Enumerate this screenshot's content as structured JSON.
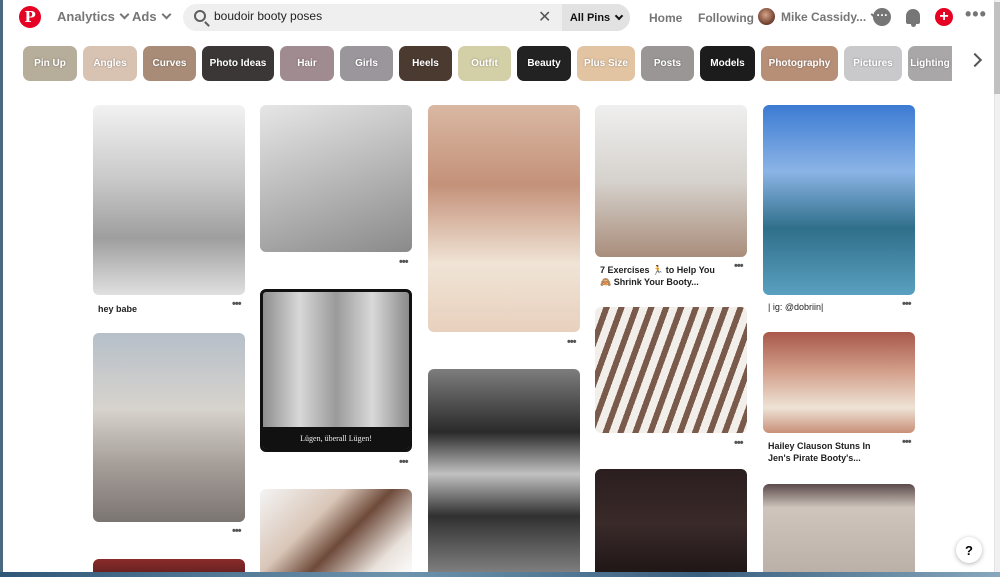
{
  "header": {
    "logo": "P",
    "analytics_label": "Analytics",
    "ads_label": "Ads",
    "search_value": "boudoir booty poses",
    "search_scope": "All Pins",
    "clear_label": "✕",
    "home_label": "Home",
    "following_label": "Following",
    "user_name": "Mike Cassidy..."
  },
  "chips": [
    {
      "label": "Pin Up",
      "color": "#b6ad9a"
    },
    {
      "label": "Angles",
      "color": "#d8c3b3"
    },
    {
      "label": "Curves",
      "color": "#a88c78"
    },
    {
      "label": "Photo Ideas",
      "color": "#3c3737"
    },
    {
      "label": "Hair",
      "color": "#a08b91"
    },
    {
      "label": "Girls",
      "color": "#9b969c"
    },
    {
      "label": "Heels",
      "color": "#4a3a30"
    },
    {
      "label": "Outfit",
      "color": "#d3cfa6"
    },
    {
      "label": "Beauty",
      "color": "#222222"
    },
    {
      "label": "Plus Size",
      "color": "#e2c4a2"
    },
    {
      "label": "Posts",
      "color": "#9a9696"
    },
    {
      "label": "Models",
      "color": "#1c1c1c"
    },
    {
      "label": "Photography",
      "color": "#b78f77"
    },
    {
      "label": "Pictures",
      "color": "#c9c9cb"
    },
    {
      "label": "Lighting",
      "color": "#a9a7a7"
    }
  ],
  "pins": [
    {
      "title": "hey babe",
      "bg": "linear-gradient(180deg,#f2f2f2 0%,#c8c8c8 40%,#9e9e9e 70%,#e0e0e0 100%)"
    },
    {
      "title": "",
      "bg": "linear-gradient(160deg,#e6e6e6 0%,#bdbdbd 45%,#8a8a8a 100%)"
    },
    {
      "title": "",
      "bg": "linear-gradient(180deg,#d9b8a3 0%,#c49179 35%,#f0e4d6 70%,#e8d0bd 100%)"
    },
    {
      "title": "7 Exercises 🏃 to Help You 🙈 Shrink Your Booty...",
      "bg": "linear-gradient(180deg,#efefef 0%,#d6d2cd 50%,#a98d7b 100%)"
    },
    {
      "title": "| ig: @dobriin|",
      "bg": "linear-gradient(180deg,#3c7bd3 0%,#8bb4e6 35%,#2f6f8a 65%,#5aa0c0 100%)"
    },
    {
      "title": "",
      "bg": "linear-gradient(180deg,#b6bfc9 0%,#d7d3cd 40%,#a59d98 70%,#7b7572 100%)"
    },
    {
      "title": "",
      "caption": "Lügen, überall Lügen!",
      "bg": "linear-gradient(90deg,#8e8e8e 0%,#d8d8d8 25%,#9a9a9a 50%,#d9d9d9 75%,#8a8a8a 100%)"
    },
    {
      "title": "",
      "bg": "linear-gradient(180deg,#7d7d7d 0%,#2a2a2a 30%,#c1c1c1 50%,#303030 70%,#888 100%)"
    },
    {
      "title": "",
      "bg": "linear-gradient(135deg,#f4f4f4 0%,#d9c6b8 35%,#6e4a3a 55%,#e9e2dc 80%,#ffffff 100%)"
    },
    {
      "title": "Hailey Clauson Stuns In Jen's Pirate Booty's...",
      "bg": "linear-gradient(180deg,#a8584a 0%,#d4a18d 40%,#eee3d6 75%,#c98f78 100%)"
    },
    {
      "title": "",
      "bg": "linear-gradient(180deg,#ececec 0%,#cfcfcf 100%)"
    },
    {
      "title": "",
      "bg": "linear-gradient(180deg,#2b1e1e 0%,#3a2a2a 50%,#1c1414 100%)"
    },
    {
      "title": "",
      "bg": "linear-gradient(180deg,#5a4a4a 0%,#cfc5bd 25%,#b9aea5 100%)"
    },
    {
      "title": "",
      "bg": "linear-gradient(180deg,#8a2b2b 0%,#5a1d1d 100%)"
    }
  ],
  "dots_label": "•••",
  "help_label": "?"
}
